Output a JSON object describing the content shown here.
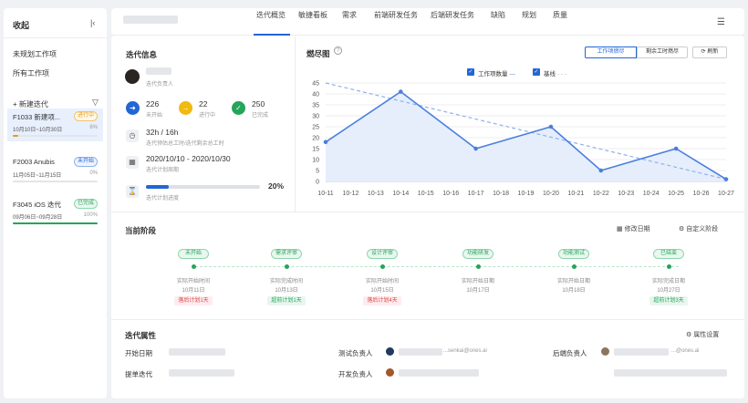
{
  "sidebar": {
    "title": "收起",
    "links": [
      "未规划工作项",
      "所有工作项"
    ],
    "new_label": "新建迭代",
    "iterations": [
      {
        "name": "F1033 新建项...",
        "status": "进行中",
        "status_color": "#e89b12",
        "dates": "10月10日~10月30日",
        "percent": "6%",
        "progress": 0.06
      },
      {
        "name": "F2003 Anubis",
        "status": "未开始",
        "status_color": "#2266d4",
        "dates": "11月05日~11月15日",
        "percent": "0%",
        "progress": 0
      },
      {
        "name": "F3045 iOS 迭代",
        "status": "已完成",
        "status_color": "#23a55a",
        "dates": "09月06日~09月28日",
        "percent": "100%",
        "progress": 1.0
      }
    ]
  },
  "nav": {
    "tabs": [
      "迭代概览",
      "敏捷看板",
      "需求",
      "前端研发任务",
      "后端研发任务",
      "缺陷",
      "规划",
      "质量"
    ],
    "active_tab": 0
  },
  "info": {
    "title": "迭代信息",
    "owner_label": "迭代负责人",
    "stats": [
      {
        "value": "226",
        "label": "未开始",
        "color": "#2266d4",
        "icon": "arrow-right-icon"
      },
      {
        "value": "22",
        "label": "进行中",
        "color": "#f2b90f",
        "icon": "in-progress-icon"
      },
      {
        "value": "250",
        "label": "已完成",
        "color": "#23a55a",
        "icon": "check-icon"
      }
    ],
    "hours": "32h / 16h",
    "hours_label": "迭代预估总工时/迭代剩余总工时",
    "period": "2020/10/10 - 2020/10/30",
    "period_label": "迭代计划周期",
    "progress_label": "迭代计划进度",
    "progress_text": "20%",
    "progress": 0.2
  },
  "burndown": {
    "title": "燃尽图",
    "toggle": [
      "工作项燃尽",
      "剩余工时燃尽"
    ],
    "refresh": "刷新",
    "legend_actual": "工作项数量",
    "legend_baseline": "基线"
  },
  "chart_data": {
    "type": "line",
    "x": [
      "10-11",
      "10-12",
      "10-13",
      "10-14",
      "10-15",
      "10-16",
      "10-17",
      "10-18",
      "10-19",
      "10-20",
      "10-21",
      "10-22",
      "10-23",
      "10-24",
      "10-25",
      "10-26",
      "10-27"
    ],
    "series": [
      {
        "name": "工作项数量",
        "color": "#4a7fe0",
        "style": "solid",
        "values": [
          18,
          null,
          null,
          41,
          null,
          null,
          15,
          null,
          null,
          25,
          null,
          5,
          null,
          null,
          15,
          null,
          1
        ]
      },
      {
        "name": "基线",
        "color": "#8fb0ee",
        "style": "dashed",
        "values": [
          45,
          null,
          null,
          null,
          null,
          null,
          null,
          null,
          null,
          null,
          null,
          null,
          null,
          null,
          null,
          null,
          1
        ]
      }
    ],
    "ylim": [
      0,
      45
    ],
    "yticks": [
      0,
      5,
      10,
      15,
      20,
      25,
      30,
      35,
      40,
      45
    ],
    "grid": true
  },
  "stages": {
    "title": "当前阶段",
    "edit_date": "修改日期",
    "custom_stage": "自定义阶段",
    "items": [
      {
        "name": "未开始",
        "kind": "实际开始时间",
        "date": "10月11日",
        "tag": "落后计划1天",
        "tag_type": "red"
      },
      {
        "name": "需求评审",
        "kind": "实际完成时间",
        "date": "10月13日",
        "tag": "超前计划1天",
        "tag_type": "green"
      },
      {
        "name": "设计评审",
        "kind": "实际开始时间",
        "date": "10月15日",
        "tag": "落后计划4天",
        "tag_type": "red"
      },
      {
        "name": "功能研发",
        "kind": "实际开始日期",
        "date": "10月17日",
        "tag": "",
        "tag_type": ""
      },
      {
        "name": "功能测试",
        "kind": "实际开始日期",
        "date": "10月18日",
        "tag": "",
        "tag_type": ""
      },
      {
        "name": "已结束",
        "kind": "实际完成日期",
        "date": "10月27日",
        "tag": "超前计划3天",
        "tag_type": "green"
      }
    ]
  },
  "attributes": {
    "title": "迭代属性",
    "settings": "属性设置",
    "start_date": "开始日期",
    "parent_iteration": "提单迭代",
    "test_owner": "测试负责人",
    "test_owner_email": "...senkai@ones.ai",
    "dev_owner": "开发负责人",
    "backend_owner": "后端负责人",
    "backend_owner_email": "...@ones.ai"
  }
}
